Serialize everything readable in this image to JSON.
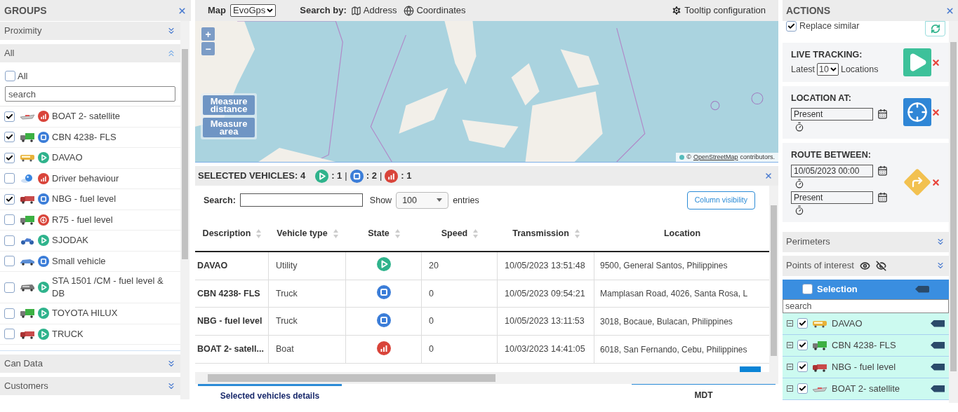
{
  "groups": {
    "title": "GROUPS",
    "sections": [
      {
        "label": "Proximity",
        "expanded": false
      },
      {
        "label": "All",
        "expanded": true,
        "select_all": {
          "label": "All",
          "checked": false
        },
        "search": {
          "placeholder": "search"
        },
        "items": [
          {
            "name": "BOAT 2- satellite",
            "checked": true,
            "vehicle": {
              "kind": "boat"
            },
            "state": {
              "kind": "signal"
            }
          },
          {
            "name": "CBN 4238- FLS",
            "checked": true,
            "vehicle": {
              "kind": "truck"
            },
            "state": {
              "kind": "stopped"
            }
          },
          {
            "name": "DAVAO",
            "checked": true,
            "vehicle": {
              "kind": "bus"
            },
            "state": {
              "kind": "moving"
            }
          },
          {
            "name": "Driver behaviour",
            "checked": false,
            "vehicle": {
              "kind": "ball"
            },
            "state": {
              "kind": "signal"
            }
          },
          {
            "name": "NBG - fuel level",
            "checked": true,
            "vehicle": {
              "kind": "lorry"
            },
            "state": {
              "kind": "stopped"
            }
          },
          {
            "name": "R75 - fuel level",
            "checked": false,
            "vehicle": {
              "kind": "truck"
            },
            "state": {
              "kind": "alert"
            }
          },
          {
            "name": "SJODAK",
            "checked": false,
            "vehicle": {
              "kind": "moto"
            },
            "state": {
              "kind": "moving"
            }
          },
          {
            "name": "Small vehicle",
            "checked": false,
            "vehicle": {
              "kind": "car"
            },
            "state": {
              "kind": "stopped"
            }
          },
          {
            "name": "STA 1501 /CM - fuel level & DB",
            "checked": false,
            "vehicle": {
              "kind": "van"
            },
            "state": {
              "kind": "moving"
            }
          },
          {
            "name": "TOYOTA HILUX",
            "checked": false,
            "vehicle": {
              "kind": "truck"
            },
            "state": {
              "kind": "moving"
            }
          },
          {
            "name": "TRUCK",
            "checked": false,
            "vehicle": {
              "kind": "lorry"
            },
            "state": {
              "kind": "moving"
            }
          }
        ]
      },
      {
        "label": "Can Data",
        "expanded": false
      },
      {
        "label": "Customers",
        "expanded": false
      }
    ]
  },
  "toolbar": {
    "map_label": "Map",
    "map_select": "EvoGps",
    "search_by": "Search by:",
    "search_options": [
      {
        "label": "Address",
        "kind": "address"
      },
      {
        "label": "Coordinates",
        "kind": "coordinates"
      }
    ],
    "tooltip_config": "Tooltip configuration"
  },
  "map": {
    "zoom_in": "+",
    "zoom_out": "−",
    "measure": [
      "Measure distance",
      "Measure area"
    ],
    "attribution": {
      "prefix": "©",
      "link": "OpenStreetMap",
      "suffix": "contributors."
    }
  },
  "selected": {
    "title": "SELECTED VEHICLES: 4",
    "separator": "|",
    "counts": [
      {
        "kind": "moving",
        "text": ": 1"
      },
      {
        "kind": "stopped",
        "text": ": 2"
      },
      {
        "kind": "signal",
        "text": ": 1"
      }
    ],
    "search_label": "Search:",
    "show_label": "Show",
    "entries_select": "100",
    "entries_label": "entries",
    "column_visibility": "Column visibility",
    "columns": [
      {
        "label": "Description",
        "sortable": true
      },
      {
        "label": "Vehicle type",
        "sortable": true
      },
      {
        "label": "State",
        "sortable": true
      },
      {
        "label": "Speed",
        "sortable": true
      },
      {
        "label": "Transmission",
        "sortable": true
      },
      {
        "label": "Location",
        "sortable": false
      }
    ],
    "rows": [
      {
        "description": "DAVAO",
        "vehicle_type": "Utility",
        "state": {
          "kind": "moving"
        },
        "speed": "20",
        "transmission": "10/05/2023 13:51:48",
        "location": "9500, General Santos, Philippines"
      },
      {
        "description": "CBN 4238- FLS",
        "vehicle_type": "Truck",
        "state": {
          "kind": "stopped"
        },
        "speed": "0",
        "transmission": "10/05/2023 09:54:21",
        "location": "Mamplasan Road, 4026, Santa Rosa, L"
      },
      {
        "description": "NBG - fuel level",
        "vehicle_type": "Truck",
        "state": {
          "kind": "stopped"
        },
        "speed": "0",
        "transmission": "10/05/2023 13:11:53",
        "location": "3018, Bocaue, Bulacan, Philippines"
      },
      {
        "description": "BOAT 2- satell...",
        "vehicle_type": "Boat",
        "state": {
          "kind": "signal"
        },
        "speed": "0",
        "transmission": "10/03/2023 14:41:05",
        "location": "6018, San Fernando, Cebu, Philippines"
      }
    ],
    "tabs": [
      {
        "label": "Selected vehicles details",
        "selected": true
      },
      {
        "label": "MDT",
        "selected": false
      }
    ]
  },
  "actions": {
    "title": "ACTIONS",
    "replace_similar": {
      "label": "Replace similar",
      "checked": true
    },
    "cards": [
      {
        "kind": "live",
        "title": "LIVE TRACKING:",
        "latest": "Latest",
        "count": "10",
        "locations": "Locations"
      },
      {
        "kind": "location",
        "title": "LOCATION AT:",
        "inputs": [
          "Present"
        ]
      },
      {
        "kind": "route",
        "title": "ROUTE BETWEEN:",
        "inputs": [
          "10/05/2023 00:00",
          "Present"
        ]
      }
    ],
    "sections": [
      {
        "label": "Perimeters",
        "expanded": false,
        "visibility_icons": false
      },
      {
        "label": "Points of interest",
        "expanded": false,
        "visibility_icons": true
      }
    ],
    "selection": {
      "label": "Selection",
      "checked": false,
      "search": {
        "placeholder": "search"
      },
      "items": [
        {
          "name": "DAVAO",
          "checked": true,
          "vehicle": {
            "kind": "bus"
          }
        },
        {
          "name": "CBN 4238- FLS",
          "checked": true,
          "vehicle": {
            "kind": "truck"
          }
        },
        {
          "name": "NBG - fuel level",
          "checked": true,
          "vehicle": {
            "kind": "lorry"
          }
        },
        {
          "name": "BOAT 2- satellite",
          "checked": true,
          "vehicle": {
            "kind": "boat"
          }
        }
      ]
    }
  }
}
